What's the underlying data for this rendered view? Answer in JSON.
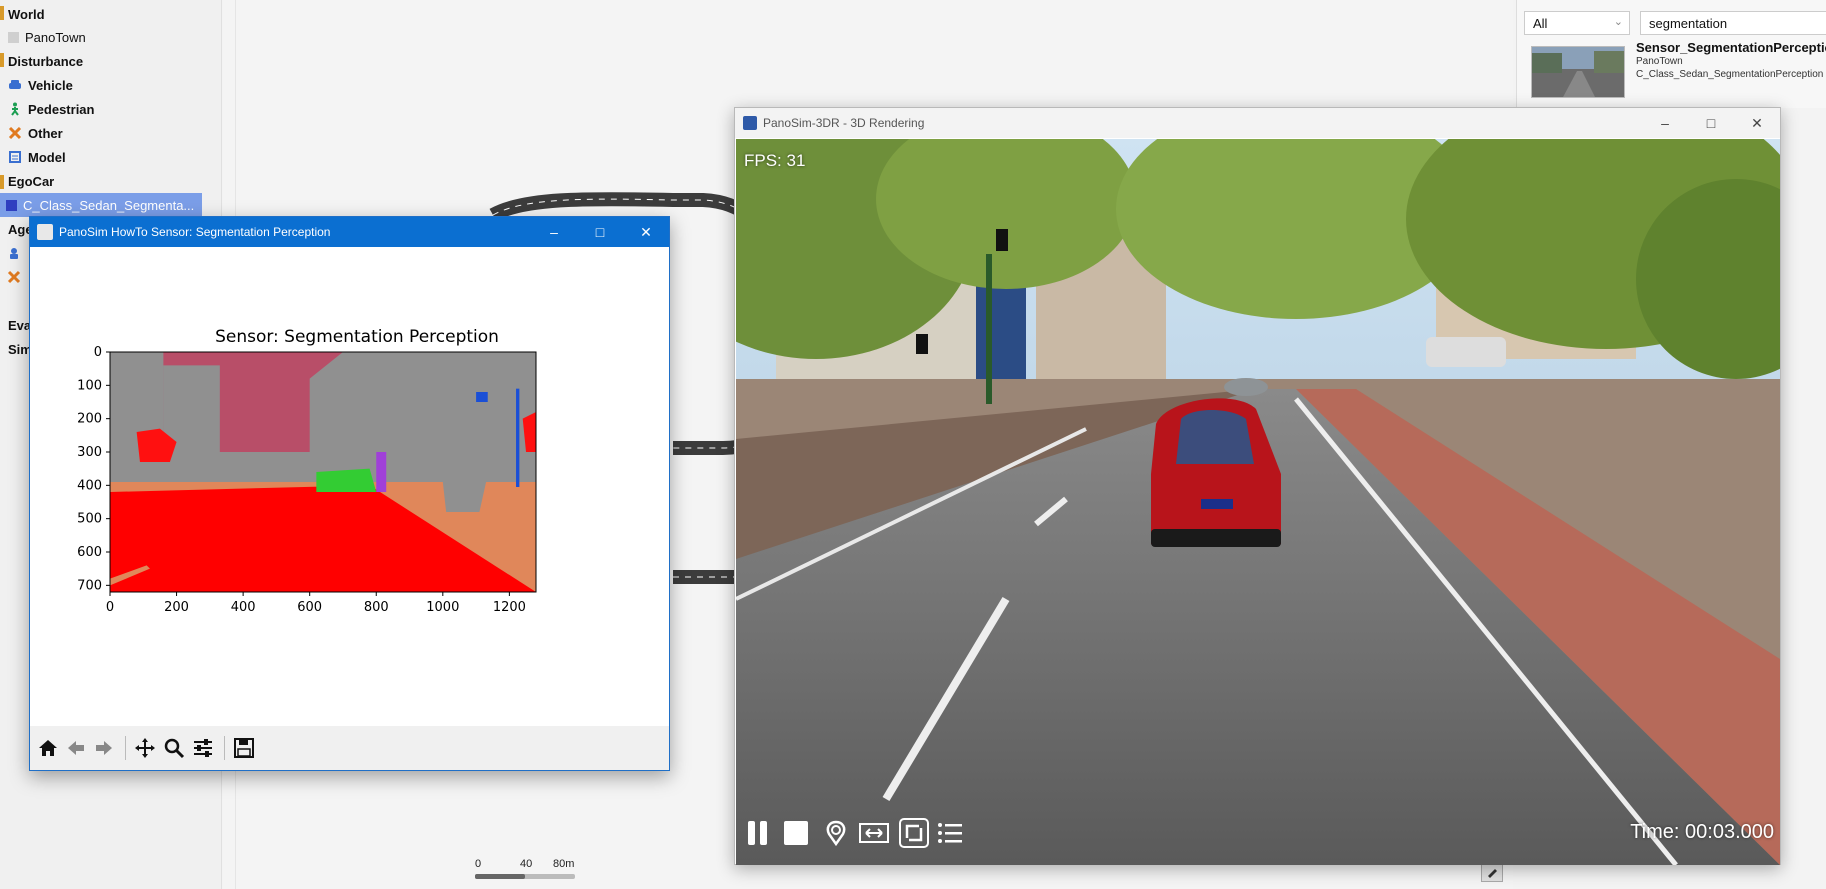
{
  "tree": {
    "items": [
      {
        "label": "World",
        "bold": true
      },
      {
        "label": "PanoTown",
        "bold": false
      },
      {
        "label": "Disturbance",
        "bold": true
      },
      {
        "label": "Vehicle",
        "bold": true
      },
      {
        "label": "Pedestrian",
        "bold": true
      },
      {
        "label": "Other",
        "bold": true
      },
      {
        "label": "Model",
        "bold": true
      },
      {
        "label": "EgoCar",
        "bold": true
      },
      {
        "label": "C_Class_Sedan_Segmenta...",
        "bold": false
      },
      {
        "label": "Age",
        "bold": true
      },
      {
        "label": "Eva",
        "bold": true
      },
      {
        "label": "Sim",
        "bold": true
      }
    ]
  },
  "canvas": {
    "scale": {
      "label0": "0",
      "label1": "40",
      "label2": "80m"
    }
  },
  "library": {
    "filter_value": "All",
    "search_value": "segmentation",
    "result": {
      "title": "Sensor_SegmentationPerception",
      "world": "PanoTown",
      "vehicle": "C_Class_Sedan_SegmentationPerception"
    }
  },
  "render_window": {
    "title": "PanoSim-3DR - 3D Rendering",
    "fps": "FPS: 31",
    "time": "Time: 00:03.000",
    "controls": [
      "pause-icon",
      "stop-icon",
      "location-icon",
      "fit-width-icon",
      "fullscreen-icon",
      "list-icon"
    ]
  },
  "figure_window": {
    "title": "PanoSim HowTo Sensor: Segmentation Perception",
    "toolbar": [
      "home-icon",
      "back-arrow-icon",
      "forward-arrow-icon",
      "pan-icon",
      "zoom-icon",
      "configure-icon",
      "save-icon"
    ]
  },
  "chart_data": {
    "type": "heatmap",
    "title": "Sensor: Segmentation Perception",
    "xlabel": "",
    "ylabel": "",
    "xlim": [
      0,
      1280
    ],
    "ylim": [
      720,
      0
    ],
    "xticks": [
      0,
      200,
      400,
      600,
      800,
      1000,
      1200
    ],
    "yticks": [
      0,
      100,
      200,
      300,
      400,
      500,
      600,
      700
    ],
    "class_colors": {
      "road": "#ff0000",
      "sidewalk": "#e0875a",
      "building": "#909090",
      "sky": "#b84e68",
      "vegetation": "#ff1010",
      "vehicle": "#33cc33",
      "pedestrian": "#a040d8",
      "traffic-light": "#1a4fd6"
    }
  },
  "colors": {
    "accent": "#0b6fd1",
    "tree_selected": "#7b9ee8"
  }
}
